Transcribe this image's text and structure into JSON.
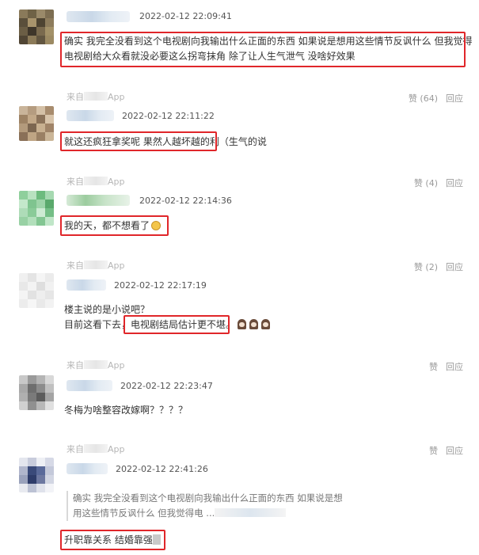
{
  "comments": [
    {
      "time": "2022-02-12 22:09:41",
      "text_lines": [
        "确实 我完全没看到这个电视剧向我输出什么正面的东西 如果说是想用这些情节反讽什么 但我觉得",
        "电视剧给大众看就没必要这么拐弯抹角 除了让人生气泄气 没啥好效果"
      ],
      "from": "来自",
      "from_suffix": "App",
      "likes": "赞 (64)",
      "reply": "回应"
    },
    {
      "time": "2022-02-12 22:11:22",
      "text_highlight": "就这还疯狂拿奖呢 果然人越坏越的利",
      "text_rest": "（生气的说",
      "from": "来自",
      "from_suffix": "App",
      "likes": "赞 (4)",
      "reply": "回应"
    },
    {
      "time": "2022-02-12 22:14:36",
      "text": "我的天，都不想看了",
      "from": "来自",
      "from_suffix": "App",
      "likes": "赞 (2)",
      "reply": "回应"
    },
    {
      "time": "2022-02-12 22:17:19",
      "line1": "楼主说的是小说吧？",
      "line2_prefix": "目前这看下去，",
      "line2_highlight": "电视剧结局估计更不堪。",
      "from": "来自",
      "from_suffix": "App",
      "likes": "赞",
      "reply": "回应"
    },
    {
      "time": "2022-02-12 22:23:47",
      "text": "冬梅为啥整容改嫁啊？？？？",
      "from": "来自",
      "from_suffix": "App",
      "likes": "赞",
      "reply": "回应"
    },
    {
      "time": "2022-02-12 22:41:26",
      "quote_line1": "确实 我完全没看到这个电视剧向我输出什么正面的东西 如果说是想",
      "quote_line2": "用这些情节反讽什么 但我觉得电 ..."
    },
    {
      "text": "升职靠关系 结婚靠强"
    }
  ]
}
